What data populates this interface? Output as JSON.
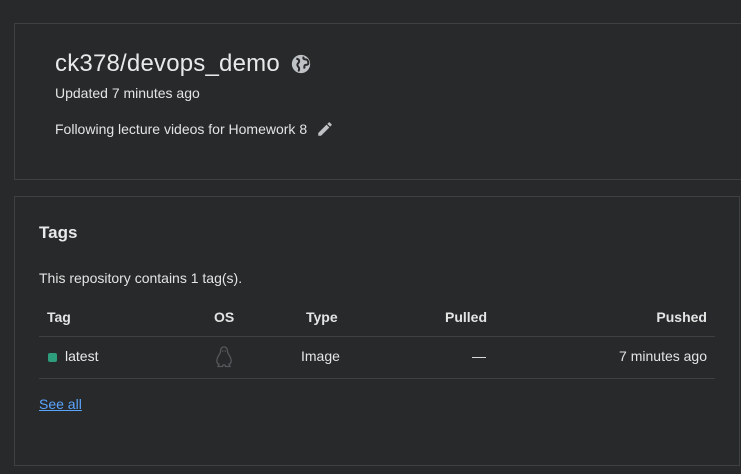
{
  "repo": {
    "name": "ck378/devops_demo",
    "updated": "Updated 7 minutes ago",
    "description": "Following lecture videos for Homework 8"
  },
  "tags": {
    "title": "Tags",
    "count_text": "This repository contains 1 tag(s).",
    "columns": [
      "Tag",
      "OS",
      "Type",
      "Pulled",
      "Pushed"
    ],
    "rows": [
      {
        "tag": "latest",
        "os_icon": "linux-icon",
        "type": "Image",
        "pulled": "—",
        "pushed": "7 minutes ago",
        "status_color": "#2e9d7b"
      }
    ],
    "see_all": "See all"
  }
}
